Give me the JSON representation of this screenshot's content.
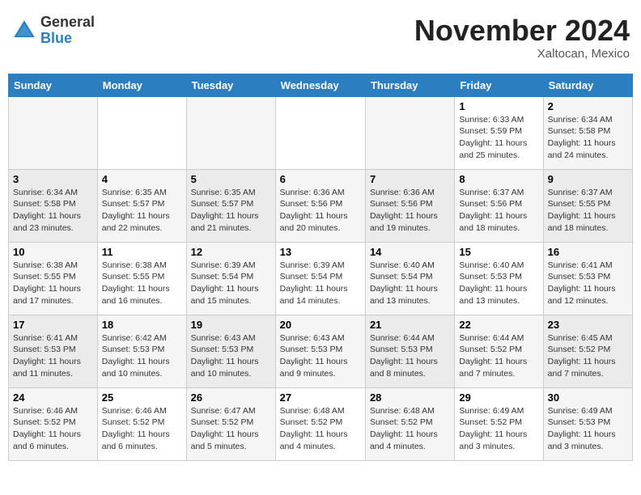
{
  "header": {
    "logo_general": "General",
    "logo_blue": "Blue",
    "month_title": "November 2024",
    "location": "Xaltocan, Mexico"
  },
  "days_of_week": [
    "Sunday",
    "Monday",
    "Tuesday",
    "Wednesday",
    "Thursday",
    "Friday",
    "Saturday"
  ],
  "weeks": [
    [
      {
        "day": "",
        "info": ""
      },
      {
        "day": "",
        "info": ""
      },
      {
        "day": "",
        "info": ""
      },
      {
        "day": "",
        "info": ""
      },
      {
        "day": "",
        "info": ""
      },
      {
        "day": "1",
        "info": "Sunrise: 6:33 AM\nSunset: 5:59 PM\nDaylight: 11 hours and 25 minutes."
      },
      {
        "day": "2",
        "info": "Sunrise: 6:34 AM\nSunset: 5:58 PM\nDaylight: 11 hours and 24 minutes."
      }
    ],
    [
      {
        "day": "3",
        "info": "Sunrise: 6:34 AM\nSunset: 5:58 PM\nDaylight: 11 hours and 23 minutes."
      },
      {
        "day": "4",
        "info": "Sunrise: 6:35 AM\nSunset: 5:57 PM\nDaylight: 11 hours and 22 minutes."
      },
      {
        "day": "5",
        "info": "Sunrise: 6:35 AM\nSunset: 5:57 PM\nDaylight: 11 hours and 21 minutes."
      },
      {
        "day": "6",
        "info": "Sunrise: 6:36 AM\nSunset: 5:56 PM\nDaylight: 11 hours and 20 minutes."
      },
      {
        "day": "7",
        "info": "Sunrise: 6:36 AM\nSunset: 5:56 PM\nDaylight: 11 hours and 19 minutes."
      },
      {
        "day": "8",
        "info": "Sunrise: 6:37 AM\nSunset: 5:56 PM\nDaylight: 11 hours and 18 minutes."
      },
      {
        "day": "9",
        "info": "Sunrise: 6:37 AM\nSunset: 5:55 PM\nDaylight: 11 hours and 18 minutes."
      }
    ],
    [
      {
        "day": "10",
        "info": "Sunrise: 6:38 AM\nSunset: 5:55 PM\nDaylight: 11 hours and 17 minutes."
      },
      {
        "day": "11",
        "info": "Sunrise: 6:38 AM\nSunset: 5:55 PM\nDaylight: 11 hours and 16 minutes."
      },
      {
        "day": "12",
        "info": "Sunrise: 6:39 AM\nSunset: 5:54 PM\nDaylight: 11 hours and 15 minutes."
      },
      {
        "day": "13",
        "info": "Sunrise: 6:39 AM\nSunset: 5:54 PM\nDaylight: 11 hours and 14 minutes."
      },
      {
        "day": "14",
        "info": "Sunrise: 6:40 AM\nSunset: 5:54 PM\nDaylight: 11 hours and 13 minutes."
      },
      {
        "day": "15",
        "info": "Sunrise: 6:40 AM\nSunset: 5:53 PM\nDaylight: 11 hours and 13 minutes."
      },
      {
        "day": "16",
        "info": "Sunrise: 6:41 AM\nSunset: 5:53 PM\nDaylight: 11 hours and 12 minutes."
      }
    ],
    [
      {
        "day": "17",
        "info": "Sunrise: 6:41 AM\nSunset: 5:53 PM\nDaylight: 11 hours and 11 minutes."
      },
      {
        "day": "18",
        "info": "Sunrise: 6:42 AM\nSunset: 5:53 PM\nDaylight: 11 hours and 10 minutes."
      },
      {
        "day": "19",
        "info": "Sunrise: 6:43 AM\nSunset: 5:53 PM\nDaylight: 11 hours and 10 minutes."
      },
      {
        "day": "20",
        "info": "Sunrise: 6:43 AM\nSunset: 5:53 PM\nDaylight: 11 hours and 9 minutes."
      },
      {
        "day": "21",
        "info": "Sunrise: 6:44 AM\nSunset: 5:53 PM\nDaylight: 11 hours and 8 minutes."
      },
      {
        "day": "22",
        "info": "Sunrise: 6:44 AM\nSunset: 5:52 PM\nDaylight: 11 hours and 7 minutes."
      },
      {
        "day": "23",
        "info": "Sunrise: 6:45 AM\nSunset: 5:52 PM\nDaylight: 11 hours and 7 minutes."
      }
    ],
    [
      {
        "day": "24",
        "info": "Sunrise: 6:46 AM\nSunset: 5:52 PM\nDaylight: 11 hours and 6 minutes."
      },
      {
        "day": "25",
        "info": "Sunrise: 6:46 AM\nSunset: 5:52 PM\nDaylight: 11 hours and 6 minutes."
      },
      {
        "day": "26",
        "info": "Sunrise: 6:47 AM\nSunset: 5:52 PM\nDaylight: 11 hours and 5 minutes."
      },
      {
        "day": "27",
        "info": "Sunrise: 6:48 AM\nSunset: 5:52 PM\nDaylight: 11 hours and 4 minutes."
      },
      {
        "day": "28",
        "info": "Sunrise: 6:48 AM\nSunset: 5:52 PM\nDaylight: 11 hours and 4 minutes."
      },
      {
        "day": "29",
        "info": "Sunrise: 6:49 AM\nSunset: 5:52 PM\nDaylight: 11 hours and 3 minutes."
      },
      {
        "day": "30",
        "info": "Sunrise: 6:49 AM\nSunset: 5:53 PM\nDaylight: 11 hours and 3 minutes."
      }
    ]
  ]
}
